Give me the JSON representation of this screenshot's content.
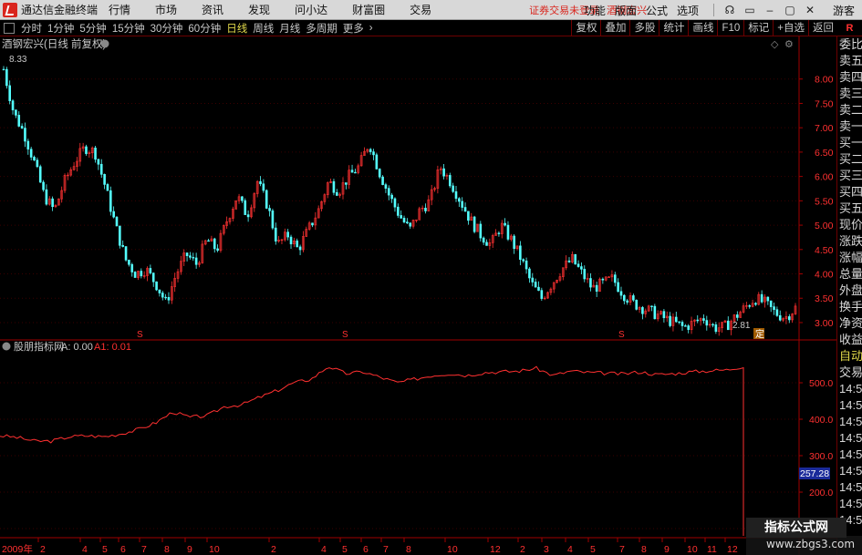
{
  "app": {
    "title": "通达信金融终端"
  },
  "menu": {
    "items": [
      "行情",
      "市场",
      "资讯",
      "发现",
      "问小达",
      "财富圈",
      "交易"
    ],
    "notice": "证券交易未登录",
    "stock_link": "酒钢宏兴",
    "right": [
      "功能",
      "版面",
      "公式",
      "选项"
    ],
    "guest": "游客",
    "window_buttons": [
      "minimize-icon",
      "restore-icon",
      "close-icon"
    ]
  },
  "toolbar": {
    "periods": [
      "分时",
      "1分钟",
      "5分钟",
      "15分钟",
      "30分钟",
      "60分钟",
      "日线",
      "周线",
      "月线",
      "多周期",
      "更多"
    ],
    "active_period": "日线",
    "tools": [
      "复权",
      "叠加",
      "多股",
      "统计",
      "画线",
      "F10",
      "标记",
      "+自选",
      "返回"
    ],
    "r_flag": "R"
  },
  "main_panel": {
    "title": "酒钢宏兴(日线 前复权)",
    "high_label": "8.33",
    "low_label": "2.81",
    "ding_marker": "定",
    "s_marker": "S",
    "y_ticks": [
      "8.00",
      "7.50",
      "7.00",
      "6.50",
      "6.00",
      "5.50",
      "5.00",
      "4.50",
      "4.00",
      "3.50",
      "3.00"
    ]
  },
  "indicator_panel": {
    "title": "股朋指标网",
    "a_label": "A: 0.00",
    "a1_label": "A1: 0.01",
    "current_value": "257.28",
    "y_ticks": [
      "500.0",
      "400.0",
      "300.0",
      "200.0",
      "100.0"
    ]
  },
  "x_axis": {
    "year_label": "2009年",
    "month_ticks": [
      "2",
      "4",
      "5",
      "6",
      "7",
      "8",
      "9",
      "10",
      "2",
      "4",
      "5",
      "6",
      "7",
      "8",
      "10",
      "12",
      "2",
      "3",
      "4",
      "5",
      "7",
      "8",
      "9",
      "10",
      "11",
      "12"
    ]
  },
  "sidebar": {
    "items": [
      "委比",
      "卖五",
      "卖四",
      "卖三",
      "卖二",
      "卖一",
      "买一",
      "买二",
      "买三",
      "买四",
      "买五",
      "现价",
      "涨跌",
      "涨幅",
      "总量",
      "外盘",
      "换手",
      "净资",
      "收益",
      "自动",
      "交易",
      "14:55",
      "14:55",
      "14:56",
      "14:56",
      "14:56",
      "14:56",
      "14:56",
      "14:56",
      "14:56"
    ]
  },
  "watermark": {
    "title": "指标公式网",
    "url": "www.zbgs3.com"
  },
  "chart_data": {
    "type": "candlestick",
    "title": "酒钢宏兴(日线 前复权)",
    "ylim": [
      2.7,
      8.5
    ],
    "y_ticks": [
      3.0,
      3.5,
      4.0,
      4.5,
      5.0,
      5.5,
      6.0,
      6.5,
      7.0,
      7.5,
      8.0
    ],
    "high": 8.33,
    "low": 2.81,
    "close_path": [
      8.2,
      7.3,
      6.9,
      6.3,
      5.6,
      5.3,
      5.9,
      6.3,
      6.6,
      6.5,
      5.8,
      5.0,
      4.3,
      4.0,
      4.1,
      3.8,
      3.4,
      4.0,
      4.4,
      4.2,
      4.7,
      4.5,
      5.1,
      5.6,
      5.2,
      5.9,
      5.4,
      4.6,
      4.8,
      4.5,
      4.9,
      5.3,
      5.9,
      5.7,
      6.0,
      6.2,
      6.7,
      6.1,
      5.6,
      5.2,
      4.9,
      5.3,
      5.5,
      6.2,
      5.9,
      5.5,
      5.1,
      4.8,
      4.6,
      5.0,
      4.7,
      4.3,
      3.8,
      3.5,
      3.8,
      4.1,
      4.3,
      4.0,
      3.7,
      3.8,
      3.9,
      3.6,
      3.4,
      3.3,
      3.2,
      3.1,
      3.0,
      2.9,
      3.0,
      3.1,
      2.9,
      2.9,
      3.1,
      3.3,
      3.5,
      3.4,
      3.2,
      3.1,
      3.3
    ],
    "indicator": {
      "ylim": [
        80,
        570
      ],
      "y_ticks": [
        100,
        200,
        300,
        400,
        500
      ],
      "current": 257.28,
      "series": [
        355,
        350,
        340,
        340,
        352,
        355,
        352,
        360,
        372,
        390,
        420,
        405,
        410,
        435,
        440,
        460,
        478,
        500,
        510,
        545,
        525,
        530,
        515,
        500,
        510,
        520,
        525,
        520,
        528,
        530,
        532,
        540,
        520,
        532,
        528,
        526,
        524,
        530,
        522,
        525,
        530,
        533,
        535,
        545
      ]
    }
  }
}
